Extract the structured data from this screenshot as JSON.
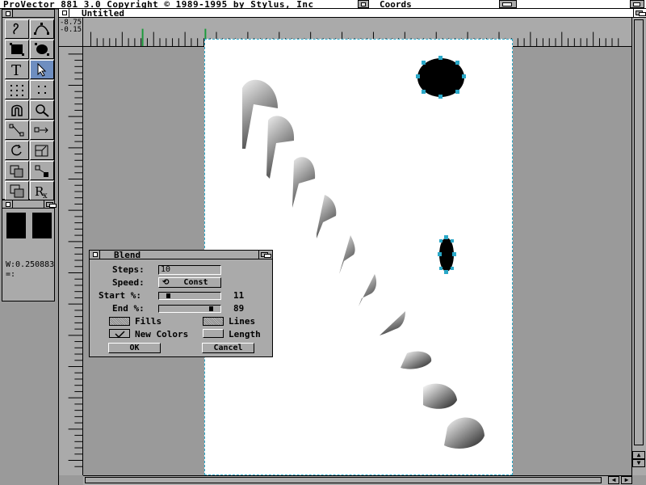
{
  "screen": {
    "title": "ProVector_881 3.0 Copyright © 1989-1995 by Stylus, Inc"
  },
  "coords_window": {
    "title": "Coords"
  },
  "document": {
    "title": "Untitled",
    "ruler_readout": "-8.75\n-0.15"
  },
  "toolbox": {
    "tools": [
      {
        "name": "freehand-icon"
      },
      {
        "name": "bezier-icon"
      },
      {
        "name": "rectangle-icon"
      },
      {
        "name": "ellipse-icon"
      },
      {
        "name": "text-icon"
      },
      {
        "name": "pointer-icon"
      },
      {
        "name": "grid-dots-icon"
      },
      {
        "name": "snap-dots-icon"
      },
      {
        "name": "magnet-icon"
      },
      {
        "name": "magnify-icon"
      },
      {
        "name": "node-connect-icon"
      },
      {
        "name": "move-arrow-icon"
      },
      {
        "name": "rotate-icon"
      },
      {
        "name": "scale-icon"
      },
      {
        "name": "duplicate-icon"
      },
      {
        "name": "distort-icon"
      },
      {
        "name": "layer-stack-icon"
      },
      {
        "name": "rx-icon"
      }
    ],
    "selected_tool": "pointer-icon"
  },
  "attributes": {
    "width_label": "W:0.250883",
    "second_label": "=:"
  },
  "blend_dialog": {
    "title": "Blend",
    "steps_label": "Steps:",
    "steps_value": "10",
    "speed_label": "Speed:",
    "speed_value": "Const",
    "start_label": "Start %:",
    "start_value": "11",
    "end_label": "End %:",
    "end_value": "89",
    "fills_label": "Fills",
    "lines_label": "Lines",
    "new_colors_label": "New Colors",
    "length_label": "Length",
    "ok_label": "OK",
    "cancel_label": "Cancel",
    "fills_checked": false,
    "lines_checked": false,
    "new_colors_checked": true,
    "length_checked": false
  },
  "colors": {
    "selection": "#2aa8c8",
    "tool_selected": "#6e8ec0",
    "ui_gray": "#aaaaaa"
  }
}
